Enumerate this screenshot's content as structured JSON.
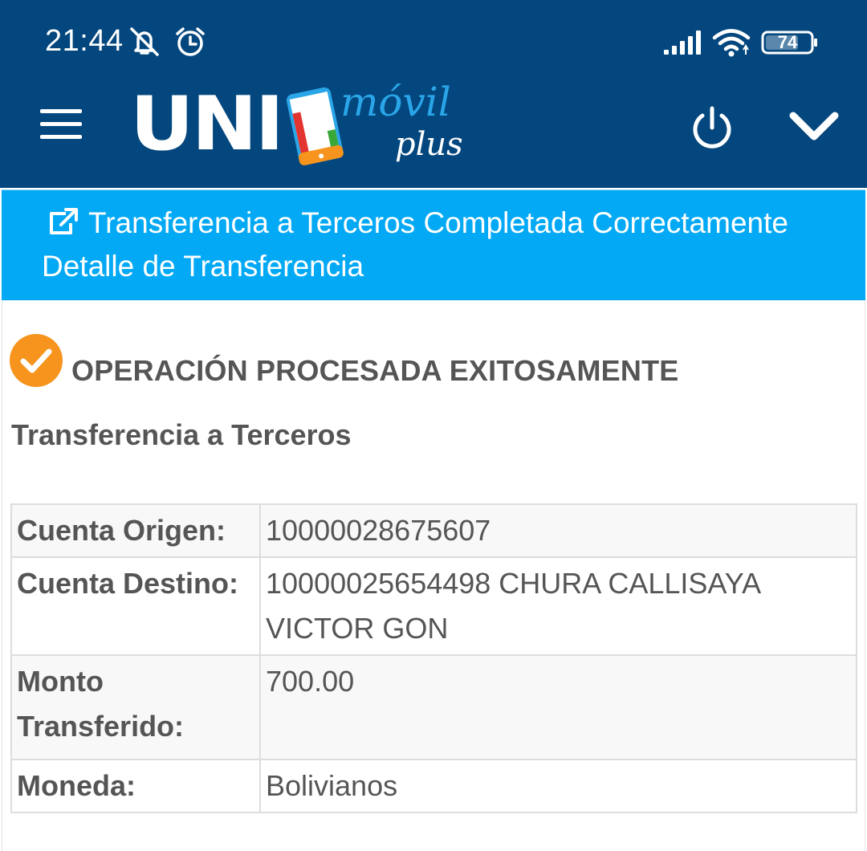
{
  "status_bar": {
    "time": "21:44",
    "battery": "74",
    "icons": [
      "mute-icon",
      "alarm-icon",
      "signal-icon",
      "wifi-icon",
      "battery-icon"
    ]
  },
  "header": {
    "logo_main": "UNI",
    "logo_script": "móvil",
    "logo_sub": "plus",
    "icons": [
      "hamburger-menu-icon",
      "power-icon",
      "chevron-down-icon"
    ]
  },
  "banner": {
    "title": "Transferencia a Terceros Completada Correctamente",
    "subtitle": "Detalle de Transferencia",
    "icon": "external-link-icon"
  },
  "result": {
    "status": "OPERACIÓN PROCESADA EXITOSAMENTE",
    "status_icon": "check-circle-icon",
    "operation": "Transferencia a Terceros"
  },
  "details": [
    {
      "label": "Cuenta Origen:",
      "value": "10000028675607"
    },
    {
      "label": "Cuenta Destino:",
      "value": "10000025654498 CHURA CALLISAYA VICTOR GON"
    },
    {
      "label": "Monto Transferido:",
      "value": "700.00"
    },
    {
      "label": "Moneda:",
      "value": "Bolivianos"
    }
  ],
  "colors": {
    "header_bg": "#03477e",
    "banner_bg": "#03a9f4",
    "success": "#f7941d",
    "text": "#555555"
  }
}
